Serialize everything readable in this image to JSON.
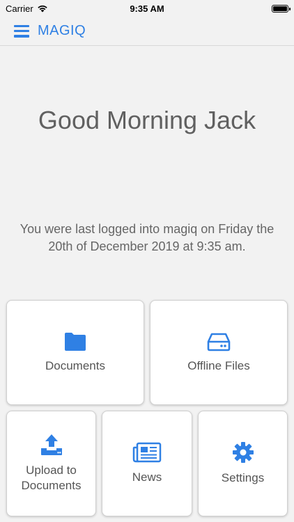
{
  "status_bar": {
    "carrier": "Carrier",
    "time": "9:35 AM"
  },
  "nav": {
    "title": "MAGIQ",
    "accent_color": "#2f80e4",
    "menu_icon": "hamburger-menu-icon"
  },
  "greeting": "Good Morning Jack",
  "last_login": "You were last logged into magiq on Friday the 20th of December 2019 at 9:35 am.",
  "tiles": [
    {
      "label": "Documents",
      "icon": "folder-icon"
    },
    {
      "label": "Offline Files",
      "icon": "hard-drive-icon"
    },
    {
      "label": "Upload to Documents",
      "icon": "upload-icon"
    },
    {
      "label": "News",
      "icon": "newspaper-icon"
    },
    {
      "label": "Settings",
      "icon": "gear-icon"
    }
  ]
}
